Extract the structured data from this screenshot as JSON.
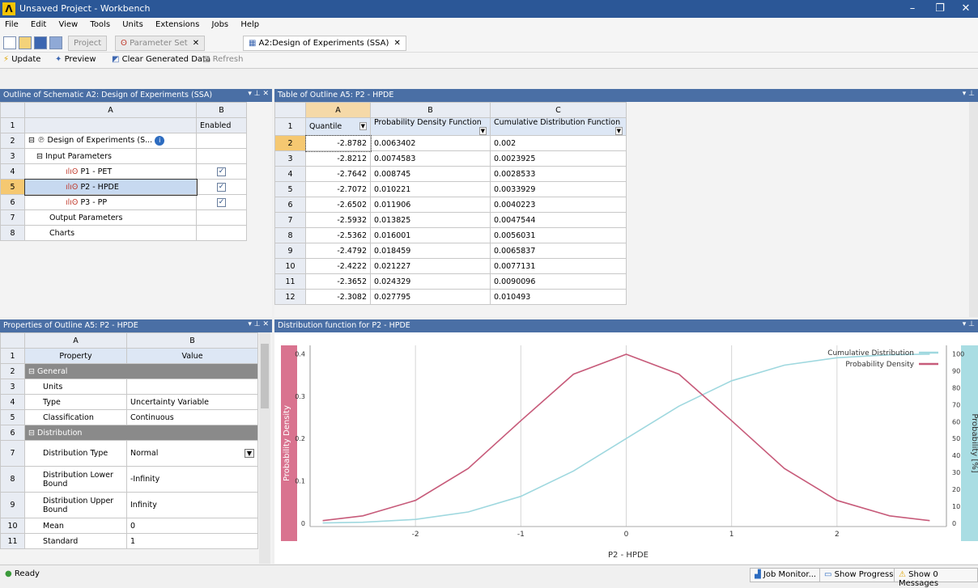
{
  "window": {
    "title": "Unsaved Project - Workbench",
    "minimize": "–",
    "restore": "❐",
    "close": "✕"
  },
  "menu": [
    "File",
    "Edit",
    "View",
    "Tools",
    "Units",
    "Extensions",
    "Jobs",
    "Help"
  ],
  "tabs": {
    "project": "Project",
    "parameter_set": "Parameter Set",
    "doe": "A2:Design of Experiments (SSA)",
    "close": "✕"
  },
  "toolbar": {
    "update": "Update",
    "preview": "Preview",
    "clear": "Clear Generated Data",
    "refresh": "Refresh"
  },
  "outline": {
    "header": "Outline of Schematic A2: Design of Experiments (SSA)",
    "col_a": "A",
    "col_b": "B",
    "enabled": "Enabled",
    "rows": [
      {
        "n": "1",
        "label": "",
        "b": ""
      },
      {
        "n": "2",
        "label": "Design of Experiments (S...",
        "b": ""
      },
      {
        "n": "3",
        "label": "Input Parameters",
        "b": ""
      },
      {
        "n": "4",
        "label": "P1 - PET",
        "b": "✓"
      },
      {
        "n": "5",
        "label": "P2 - HPDE",
        "b": "✓"
      },
      {
        "n": "6",
        "label": "P3 - PP",
        "b": "✓"
      },
      {
        "n": "7",
        "label": "Output Parameters",
        "b": ""
      },
      {
        "n": "8",
        "label": "Charts",
        "b": ""
      }
    ]
  },
  "table": {
    "header": "Table of Outline A5: P2 - HPDE",
    "cols": [
      "A",
      "B",
      "C"
    ],
    "col_titles": [
      "Quantile",
      "Probability Density Function",
      "Cumulative Distribution Function"
    ],
    "rows": [
      {
        "n": "2",
        "a": "-2.8782",
        "b": "0.0063402",
        "c": "0.002"
      },
      {
        "n": "3",
        "a": "-2.8212",
        "b": "0.0074583",
        "c": "0.0023925"
      },
      {
        "n": "4",
        "a": "-2.7642",
        "b": "0.008745",
        "c": "0.0028533"
      },
      {
        "n": "5",
        "a": "-2.7072",
        "b": "0.010221",
        "c": "0.0033929"
      },
      {
        "n": "6",
        "a": "-2.6502",
        "b": "0.011906",
        "c": "0.0040223"
      },
      {
        "n": "7",
        "a": "-2.5932",
        "b": "0.013825",
        "c": "0.0047544"
      },
      {
        "n": "8",
        "a": "-2.5362",
        "b": "0.016001",
        "c": "0.0056031"
      },
      {
        "n": "9",
        "a": "-2.4792",
        "b": "0.018459",
        "c": "0.0065837"
      },
      {
        "n": "10",
        "a": "-2.4222",
        "b": "0.021227",
        "c": "0.0077131"
      },
      {
        "n": "11",
        "a": "-2.3652",
        "b": "0.024329",
        "c": "0.0090096"
      },
      {
        "n": "12",
        "a": "-2.3082",
        "b": "0.027795",
        "c": "0.010493"
      }
    ]
  },
  "properties": {
    "header": "Properties of Outline A5: P2 - HPDE",
    "col_a": "A",
    "col_b": "B",
    "property": "Property",
    "value": "Value",
    "rows": [
      {
        "n": "2",
        "a": "General",
        "b": "",
        "group": true
      },
      {
        "n": "3",
        "a": "Units",
        "b": ""
      },
      {
        "n": "4",
        "a": "Type",
        "b": "Uncertainty Variable"
      },
      {
        "n": "5",
        "a": "Classification",
        "b": "Continuous"
      },
      {
        "n": "6",
        "a": "Distribution",
        "b": "",
        "group": true
      },
      {
        "n": "7",
        "a": "Distribution Type",
        "b": "Normal"
      },
      {
        "n": "8",
        "a": "Distribution Lower Bound",
        "b": "-Infinity"
      },
      {
        "n": "9",
        "a": "Distribution Upper Bound",
        "b": "Infinity"
      },
      {
        "n": "10",
        "a": "Mean",
        "b": "0"
      },
      {
        "n": "11",
        "a": "Standard",
        "b": "1"
      }
    ]
  },
  "chart_panel": {
    "header": "Distribution function for P2 - HPDE"
  },
  "chart_data": {
    "type": "line",
    "xlabel": "P2 - HPDE",
    "ylabel_left": "Probability Density",
    "ylabel_right": "Probability [%]",
    "xlim": [
      -3,
      3
    ],
    "ylim_left": [
      0,
      0.42
    ],
    "ylim_right": [
      0,
      105
    ],
    "x_ticks": [
      -2,
      -1,
      0,
      1,
      2
    ],
    "y_ticks_left": [
      0,
      0.1,
      0.2,
      0.3,
      0.4
    ],
    "y_ticks_right": [
      0,
      10,
      20,
      30,
      40,
      50,
      60,
      70,
      80,
      90,
      100
    ],
    "legend_position": "top-right",
    "series": [
      {
        "name": "Cumulative Distribution",
        "color": "#9fd8df",
        "axis": "right",
        "x": [
          -2.88,
          -2.5,
          -2,
          -1.5,
          -1,
          -0.5,
          0,
          0.5,
          1,
          1.5,
          2,
          2.5,
          2.88
        ],
        "values": [
          0.2,
          0.6,
          2.3,
          6.7,
          15.9,
          30.9,
          50,
          69.1,
          84.1,
          93.3,
          97.7,
          99.4,
          99.8
        ]
      },
      {
        "name": "Probability Density",
        "color": "#c75b7a",
        "axis": "left",
        "x": [
          -2.88,
          -2.5,
          -2,
          -1.5,
          -1,
          -0.5,
          0,
          0.5,
          1,
          1.5,
          2,
          2.5,
          2.88
        ],
        "values": [
          0.0063,
          0.0175,
          0.054,
          0.1295,
          0.242,
          0.352,
          0.399,
          0.352,
          0.242,
          0.1295,
          0.054,
          0.0175,
          0.0063
        ]
      }
    ]
  },
  "status": {
    "ready": "Ready",
    "job_monitor": "Job Monitor...",
    "show_progress": "Show Progress",
    "show_messages": "Show 0 Messages"
  }
}
